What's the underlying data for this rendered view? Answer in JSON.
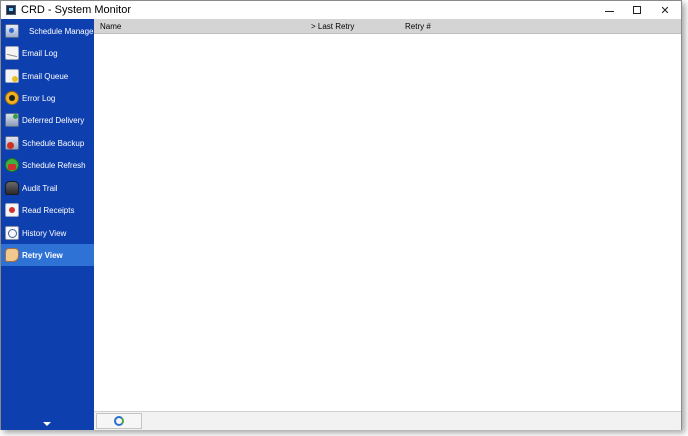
{
  "window": {
    "title": "CRD - System Monitor",
    "icon": "app-monitor-icon",
    "controls": [
      "minimize-icon",
      "maximize-icon",
      "close-icon"
    ],
    "close_glyph": "✕"
  },
  "sidebar": {
    "items": [
      {
        "label": "Schedule Manager",
        "icon": "schedule-manager-icon",
        "active": false
      },
      {
        "label": "Email Log",
        "icon": "email-log-icon",
        "active": false
      },
      {
        "label": "Email Queue",
        "icon": "email-queue-icon",
        "active": false
      },
      {
        "label": "Error Log",
        "icon": "error-log-icon",
        "active": false
      },
      {
        "label": "Deferred Delivery",
        "icon": "deferred-delivery-icon",
        "active": false
      },
      {
        "label": "Schedule Backup",
        "icon": "schedule-backup-icon",
        "active": false
      },
      {
        "label": "Schedule Refresh",
        "icon": "schedule-refresh-icon",
        "active": false
      },
      {
        "label": "Audit Trail",
        "icon": "audit-trail-icon",
        "active": false
      },
      {
        "label": "Read Receipts",
        "icon": "read-receipts-icon",
        "active": false
      },
      {
        "label": "History View",
        "icon": "history-view-icon",
        "active": false
      },
      {
        "label": "Retry View",
        "icon": "retry-view-icon",
        "active": true
      }
    ],
    "expand_icon": "chevron-down-icon"
  },
  "list": {
    "columns": [
      "Name",
      "> Last Retry",
      "Retry #"
    ],
    "rows": []
  },
  "statusbar": {
    "refresh_icon": "refresh-icon"
  },
  "colors": {
    "sidebar_bg": "#0e3fae",
    "active_item": "#2f72d6",
    "header_bg": "#d4d4d4"
  }
}
